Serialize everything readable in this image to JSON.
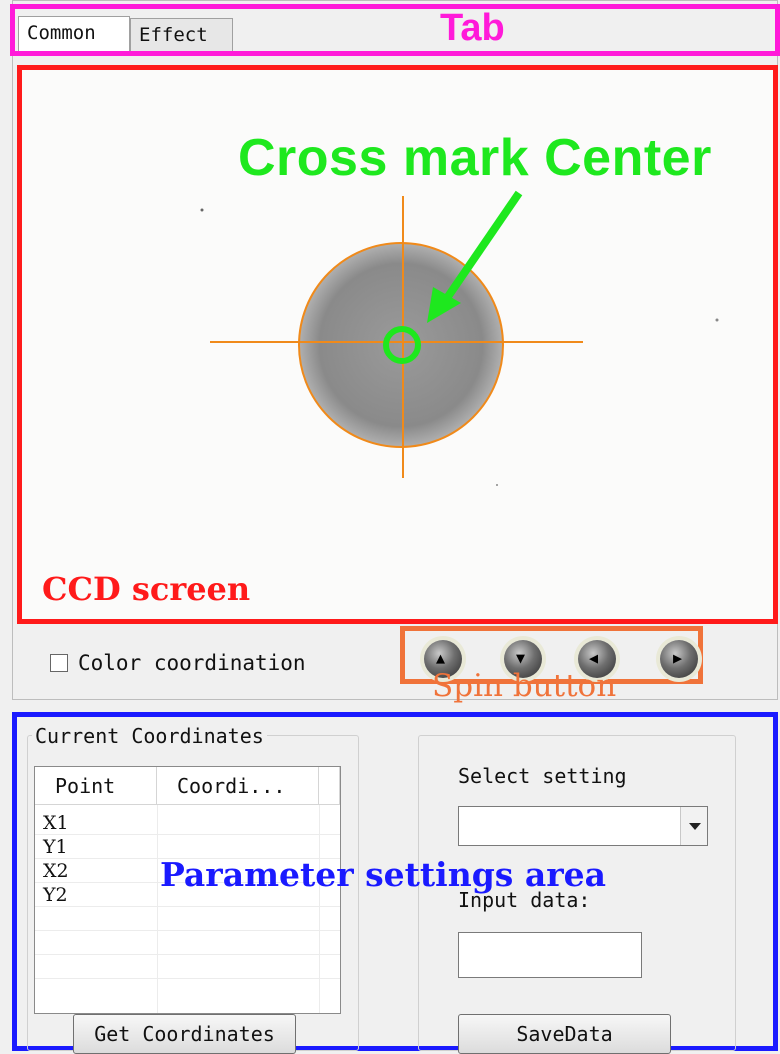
{
  "tabs": [
    {
      "label": "Common",
      "selected": true
    },
    {
      "label": "Effect",
      "selected": false
    }
  ],
  "annotations": {
    "tab": "Tab",
    "ccd_screen": "CCD screen",
    "cross_mark_center": "Cross mark Center",
    "spin_button": "Spin button",
    "parameter_area": "Parameter settings area"
  },
  "ccd_controls": {
    "color_coordination_label": "Color coordination",
    "color_coordination_checked": false,
    "spin_buttons": [
      {
        "name": "up",
        "icon": "arrow-up-icon",
        "glyph": "▲"
      },
      {
        "name": "down",
        "icon": "arrow-down-icon",
        "glyph": "▼"
      },
      {
        "name": "left",
        "icon": "arrow-left-icon",
        "glyph": "◀"
      },
      {
        "name": "right",
        "icon": "arrow-right-icon",
        "glyph": "▶"
      }
    ]
  },
  "current_coordinates": {
    "title": "Current Coordinates",
    "columns": [
      "Point",
      "Coordi..."
    ],
    "rows": [
      {
        "point": "X1",
        "value": ""
      },
      {
        "point": "Y1",
        "value": ""
      },
      {
        "point": "X2",
        "value": ""
      },
      {
        "point": "Y2",
        "value": ""
      }
    ],
    "button_label": "Get Coordinates"
  },
  "settings": {
    "select_label": "Select setting",
    "select_value": "",
    "input_label": "Input data:",
    "input_value": "",
    "save_label": "SaveData"
  },
  "colors": {
    "tab_annotation": "#ff1ad9",
    "ccd_annotation": "#ff1a1a",
    "cross_mark": "#1ee81e",
    "crosshair": "#f08a1a",
    "spin_annotation": "#f0733a",
    "parameter_annotation": "#1a1aff"
  }
}
